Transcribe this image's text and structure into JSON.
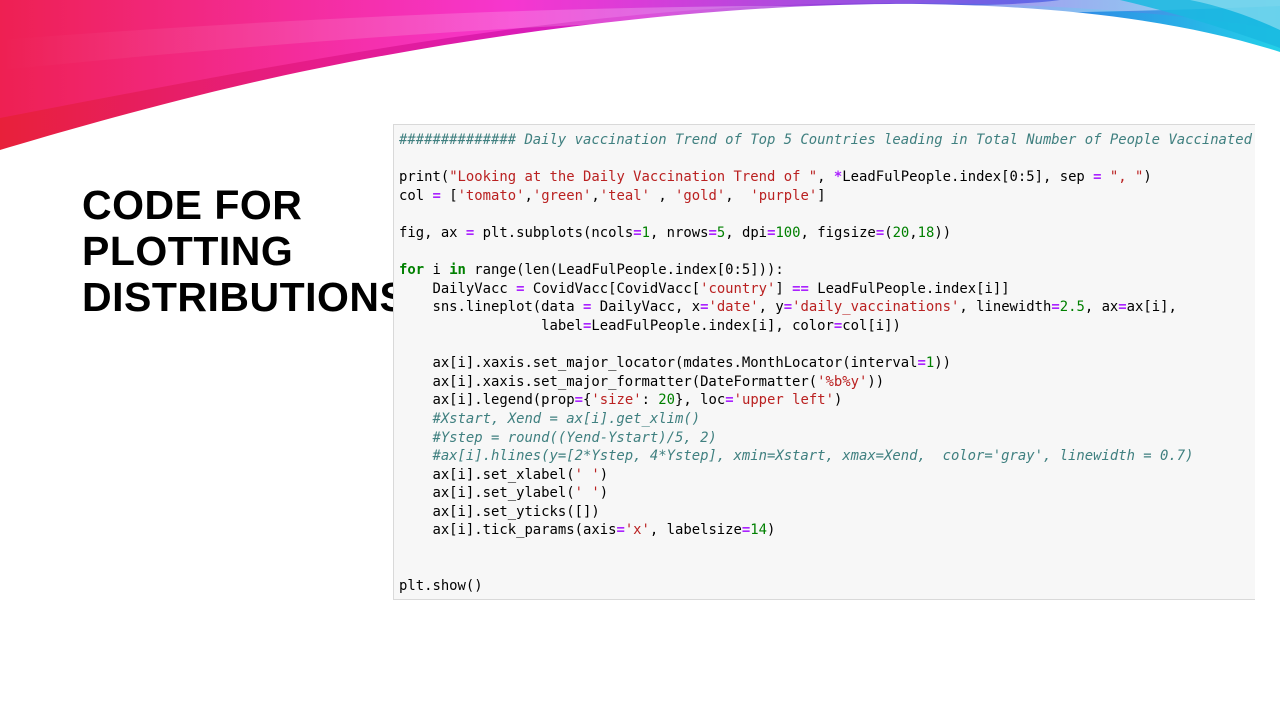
{
  "slide": {
    "title_lines": [
      "CODE FOR",
      "PLOTTING",
      "DISTRIBUTIONS"
    ]
  },
  "colors": {
    "comment": "#408080",
    "string": "#ba2121",
    "keyword": "#008000",
    "number": "#008000",
    "operator": "#aa22ff",
    "banner_magenta": "#e61cc8",
    "banner_red": "#e8203a",
    "banner_cyan": "#23b8e0"
  },
  "code": {
    "lines": [
      [
        [
          "cm",
          "############## Daily vaccination Trend of Top 5 Countries leading in Total Number of People Vaccinated"
        ]
      ],
      [],
      [
        [
          "pl",
          "print("
        ],
        [
          "st",
          "\"Looking at the Daily Vaccination Trend of \""
        ],
        [
          "pl",
          ", "
        ],
        [
          "op",
          "*"
        ],
        [
          "pl",
          "LeadFulPeople.index[0:5], sep "
        ],
        [
          "op",
          "="
        ],
        [
          "pl",
          " "
        ],
        [
          "st",
          "\", \""
        ],
        [
          "pl",
          ")"
        ]
      ],
      [
        [
          "pl",
          "col "
        ],
        [
          "op",
          "="
        ],
        [
          "pl",
          " ["
        ],
        [
          "st",
          "'tomato'"
        ],
        [
          "pl",
          ","
        ],
        [
          "st",
          "'green'"
        ],
        [
          "pl",
          ","
        ],
        [
          "st",
          "'teal'"
        ],
        [
          "pl",
          " , "
        ],
        [
          "st",
          "'gold'"
        ],
        [
          "pl",
          ",  "
        ],
        [
          "st",
          "'purple'"
        ],
        [
          "pl",
          "]"
        ]
      ],
      [],
      [
        [
          "pl",
          "fig, ax "
        ],
        [
          "op",
          "="
        ],
        [
          "pl",
          " plt.subplots(ncols"
        ],
        [
          "op",
          "="
        ],
        [
          "nu",
          "1"
        ],
        [
          "pl",
          ", nrows"
        ],
        [
          "op",
          "="
        ],
        [
          "nu",
          "5"
        ],
        [
          "pl",
          ", dpi"
        ],
        [
          "op",
          "="
        ],
        [
          "nu",
          "100"
        ],
        [
          "pl",
          ", figsize"
        ],
        [
          "op",
          "="
        ],
        [
          "pl",
          "("
        ],
        [
          "nu",
          "20"
        ],
        [
          "pl",
          ","
        ],
        [
          "nu",
          "18"
        ],
        [
          "pl",
          "))"
        ]
      ],
      [],
      [
        [
          "kw",
          "for"
        ],
        [
          "pl",
          " i "
        ],
        [
          "kw",
          "in"
        ],
        [
          "pl",
          " range(len(LeadFulPeople.index[0:5])):"
        ]
      ],
      [
        [
          "pl",
          "    DailyVacc "
        ],
        [
          "op",
          "="
        ],
        [
          "pl",
          " CovidVacc[CovidVacc["
        ],
        [
          "st",
          "'country'"
        ],
        [
          "pl",
          "] "
        ],
        [
          "op",
          "=="
        ],
        [
          "pl",
          " LeadFulPeople.index[i]]"
        ]
      ],
      [
        [
          "pl",
          "    sns.lineplot(data "
        ],
        [
          "op",
          "="
        ],
        [
          "pl",
          " DailyVacc, x"
        ],
        [
          "op",
          "="
        ],
        [
          "st",
          "'date'"
        ],
        [
          "pl",
          ", y"
        ],
        [
          "op",
          "="
        ],
        [
          "st",
          "'daily_vaccinations'"
        ],
        [
          "pl",
          ", linewidth"
        ],
        [
          "op",
          "="
        ],
        [
          "nu",
          "2.5"
        ],
        [
          "pl",
          ", ax"
        ],
        [
          "op",
          "="
        ],
        [
          "pl",
          "ax[i],"
        ]
      ],
      [
        [
          "pl",
          "                 label"
        ],
        [
          "op",
          "="
        ],
        [
          "pl",
          "LeadFulPeople.index[i], color"
        ],
        [
          "op",
          "="
        ],
        [
          "pl",
          "col[i])"
        ]
      ],
      [],
      [
        [
          "pl",
          "    ax[i].xaxis.set_major_locator(mdates.MonthLocator(interval"
        ],
        [
          "op",
          "="
        ],
        [
          "nu",
          "1"
        ],
        [
          "pl",
          "))"
        ]
      ],
      [
        [
          "pl",
          "    ax[i].xaxis.set_major_formatter(DateFormatter("
        ],
        [
          "st",
          "'%b%y'"
        ],
        [
          "pl",
          "))"
        ]
      ],
      [
        [
          "pl",
          "    ax[i].legend(prop"
        ],
        [
          "op",
          "="
        ],
        [
          "pl",
          "{"
        ],
        [
          "st",
          "'size'"
        ],
        [
          "pl",
          ": "
        ],
        [
          "nu",
          "20"
        ],
        [
          "pl",
          "}, loc"
        ],
        [
          "op",
          "="
        ],
        [
          "st",
          "'upper left'"
        ],
        [
          "pl",
          ")"
        ]
      ],
      [
        [
          "cm",
          "    #Xstart, Xend = ax[i].get_xlim()"
        ]
      ],
      [
        [
          "cm",
          "    #Ystep = round((Yend-Ystart)/5, 2)"
        ]
      ],
      [
        [
          "cm",
          "    #ax[i].hlines(y=[2*Ystep, 4*Ystep], xmin=Xstart, xmax=Xend,  color='gray', linewidth = 0.7)"
        ]
      ],
      [
        [
          "pl",
          "    ax[i].set_xlabel("
        ],
        [
          "st",
          "' '"
        ],
        [
          "pl",
          ")"
        ]
      ],
      [
        [
          "pl",
          "    ax[i].set_ylabel("
        ],
        [
          "st",
          "' '"
        ],
        [
          "pl",
          ")"
        ]
      ],
      [
        [
          "pl",
          "    ax[i].set_yticks([])"
        ]
      ],
      [
        [
          "pl",
          "    ax[i].tick_params(axis"
        ],
        [
          "op",
          "="
        ],
        [
          "st",
          "'x'"
        ],
        [
          "pl",
          ", labelsize"
        ],
        [
          "op",
          "="
        ],
        [
          "nu",
          "14"
        ],
        [
          "pl",
          ")"
        ]
      ],
      [],
      [],
      [
        [
          "pl",
          "plt.show()"
        ]
      ]
    ]
  }
}
